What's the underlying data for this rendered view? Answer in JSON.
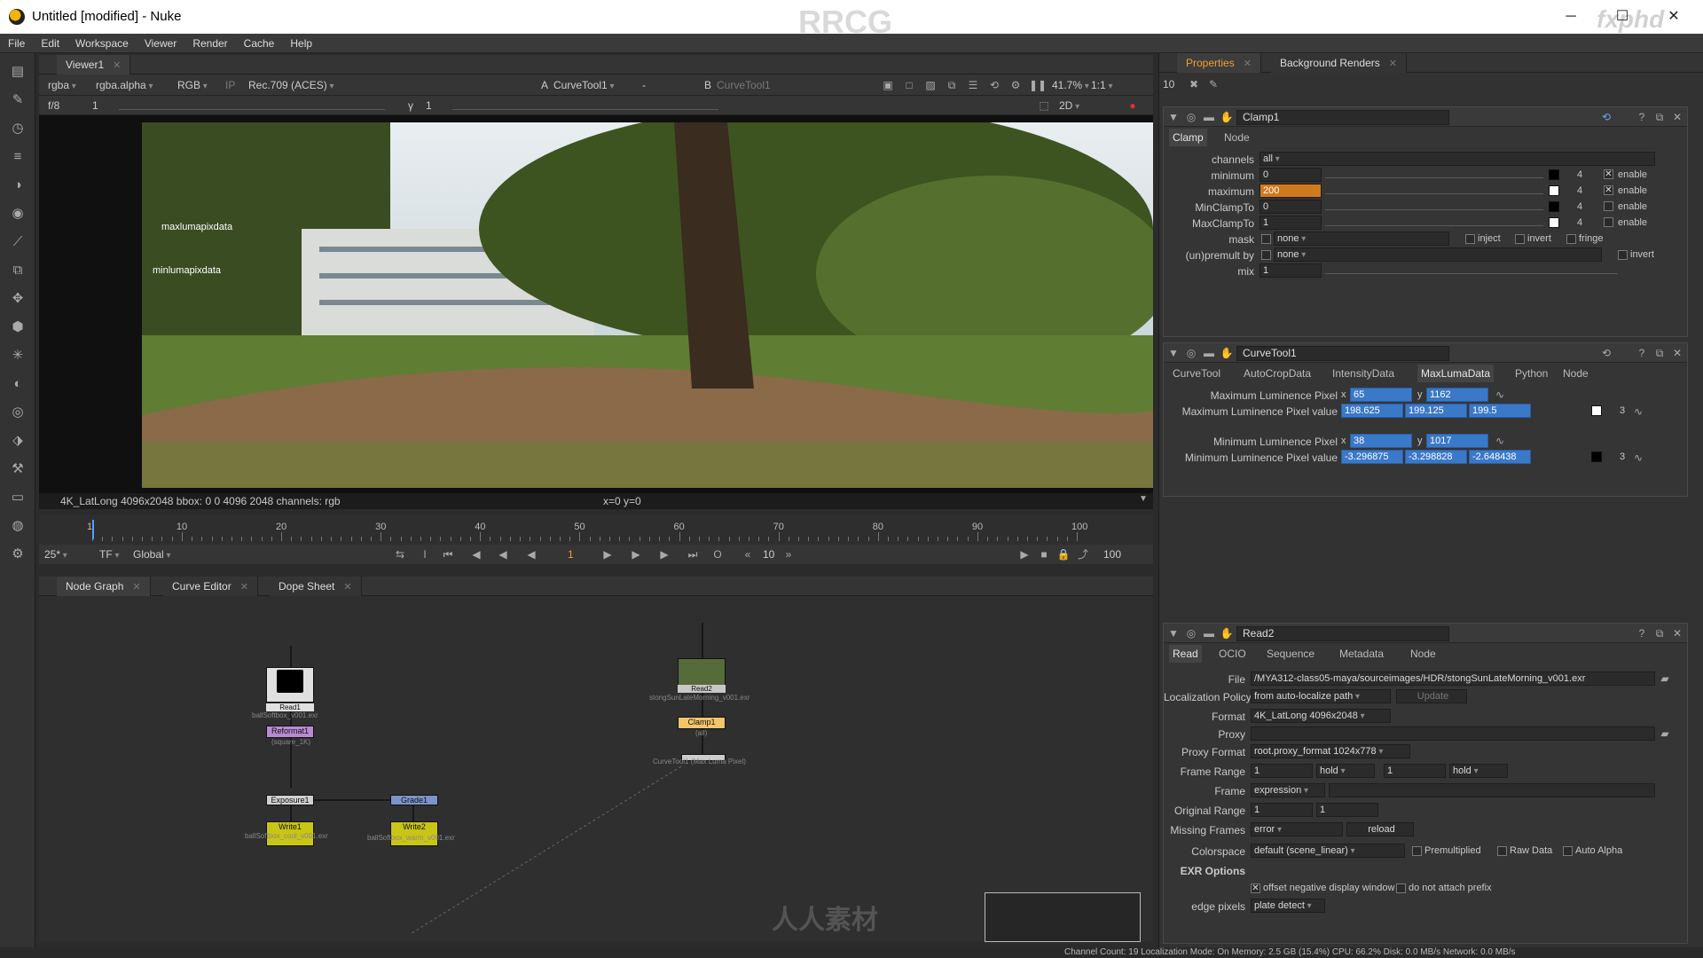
{
  "window": {
    "title": "Untitled [modified] - Nuke",
    "watermark_top": "RRCG",
    "watermark_corner": "fxphd",
    "watermark_bottom": "人人素材",
    "minimize": "─",
    "maximize": "☐",
    "close": "✕"
  },
  "menu": [
    "File",
    "Edit",
    "Workspace",
    "Viewer",
    "Render",
    "Cache",
    "Help"
  ],
  "viewer": {
    "tab": "Viewer1",
    "channels": "rgba",
    "alpha": "rgba.alpha",
    "display": "RGB",
    "ip": "IP",
    "colorspace": "Rec.709 (ACES)",
    "input_a_label": "A",
    "input_a": "CurveTool1",
    "minus": "-",
    "input_b_label": "B",
    "input_b": "CurveTool1",
    "zoom": "41.7%",
    "ratio": "1:1",
    "fstop": "f/8",
    "frame_gain": "1",
    "gamma_label": "γ",
    "gamma": "1",
    "view_mode": "2D",
    "overlay_max": "maxlumapixdata",
    "overlay_min": "minlumapixdata",
    "info": "4K_LatLong 4096x2048  bbox: 0 0 4096 2048 channels: rgb",
    "coords": "x=0 y=0"
  },
  "timeline": {
    "start": "1",
    "end": "100",
    "ticks": [
      "1",
      "10",
      "20",
      "30",
      "40",
      "50",
      "60",
      "70",
      "80",
      "90",
      "100"
    ],
    "fps": "25*",
    "tf": "TF",
    "scope": "Global",
    "current_frame": "1",
    "step": "10",
    "end_frame": "100"
  },
  "graph_tabs": [
    "Node Graph",
    "Curve Editor",
    "Dope Sheet"
  ],
  "nodes": {
    "read1": "Read1",
    "read1_file": "ballSoftbox_v001.exr",
    "reformat1": "Reformat1",
    "reformat1_sub": "(square_1K)",
    "exposure1": "Exposure1",
    "grade1": "Grade1",
    "write1": "Write1",
    "write1_file": "ballSoftbox_cool_v001.exr",
    "write2": "Write2",
    "write2_file": "ballSoftbox_warm_v001.exr",
    "read2": "Read2",
    "read2_file": "stongSunLateMorning_v001.exr",
    "clamp1": "Clamp1",
    "clamp1_sub": "(all)",
    "curvetool1": "CurveTool1 (Max Luma Pixel)"
  },
  "props_tabs": [
    "Properties",
    "Background Renders"
  ],
  "props_count": "10",
  "clamp": {
    "name": "Clamp1",
    "tabs": [
      "Clamp",
      "Node"
    ],
    "channels_label": "channels",
    "channels": "all",
    "minimum_label": "minimum",
    "minimum": "0",
    "maximum_label": "maximum",
    "maximum": "200",
    "minclampto_label": "MinClampTo",
    "minclampto": "0",
    "maxclampto_label": "MaxClampTo",
    "maxclampto": "1",
    "enable": "enable",
    "count": "4",
    "mask_label": "mask",
    "mask": "none",
    "inject": "inject",
    "invert": "invert",
    "fringe": "fringe",
    "unpremult_label": "(un)premult by",
    "unpremult": "none",
    "mix_label": "mix",
    "mix": "1",
    "scale": [
      "0",
      "0.01",
      "0.1",
      "1",
      "5",
      "10",
      "50",
      "100",
      "200"
    ]
  },
  "curvetool": {
    "name": "CurveTool1",
    "tabs": [
      "CurveTool",
      "AutoCropData",
      "IntensityData",
      "MaxLumaData",
      "Python",
      "Node"
    ],
    "max_pixel_label": "Maximum Luminence Pixel",
    "max_x": "65",
    "max_y": "1162",
    "max_value_label": "Maximum Luminence Pixel value",
    "max_values": [
      "198.625",
      "199.125",
      "199.5"
    ],
    "min_pixel_label": "Minimum Luminence Pixel",
    "min_x": "38",
    "min_y": "1017",
    "min_value_label": "Minimum Luminence Pixel value",
    "min_values": [
      "-3.296875",
      "-3.298828",
      "-2.648438"
    ],
    "x_label": "x",
    "y_label": "y",
    "count": "3"
  },
  "read2": {
    "name": "Read2",
    "tabs": [
      "Read",
      "OCIO",
      "Sequence",
      "Metadata",
      "Node"
    ],
    "file_label": "File",
    "file": "/MYA312-class05-maya/sourceimages/HDR/stongSunLateMorning_v001.exr",
    "localization_label": "Localization Policy",
    "localization": "from auto-localize path",
    "update": "Update",
    "format_label": "Format",
    "format": "4K_LatLong 4096x2048",
    "proxy_label": "Proxy",
    "proxy": "",
    "proxy_format_label": "Proxy Format",
    "proxy_format": "root.proxy_format 1024x778",
    "frame_range_label": "Frame Range",
    "range_start": "1",
    "range_start_mode": "hold",
    "range_end": "1",
    "range_end_mode": "hold",
    "frame_label": "Frame",
    "frame": "expression",
    "original_range_label": "Original Range",
    "orig_start": "1",
    "orig_end": "1",
    "missing_label": "Missing Frames",
    "missing": "error",
    "reload": "reload",
    "colorspace_label": "Colorspace",
    "colorspace": "default (scene_linear)",
    "premultiplied": "Premultiplied",
    "raw_data": "Raw Data",
    "auto_alpha": "Auto Alpha",
    "exr_options": "EXR Options",
    "offset_negative": "offset negative display window",
    "no_prefix": "do not attach prefix",
    "edge_label": "edge pixels",
    "edge": "plate detect"
  },
  "status": "Channel Count: 19 Localization Mode: On Memory: 2.5 GB (15.4%) CPU: 66.2% Disk: 0.0 MB/s Network: 0.0 MB/s",
  "colors": {
    "accent_blue": "#3a78c8",
    "accent_orange": "#d07a1e",
    "node_yellow": "#c9c515",
    "node_purple": "#b88ad6",
    "node_blue": "#7e93c9"
  }
}
